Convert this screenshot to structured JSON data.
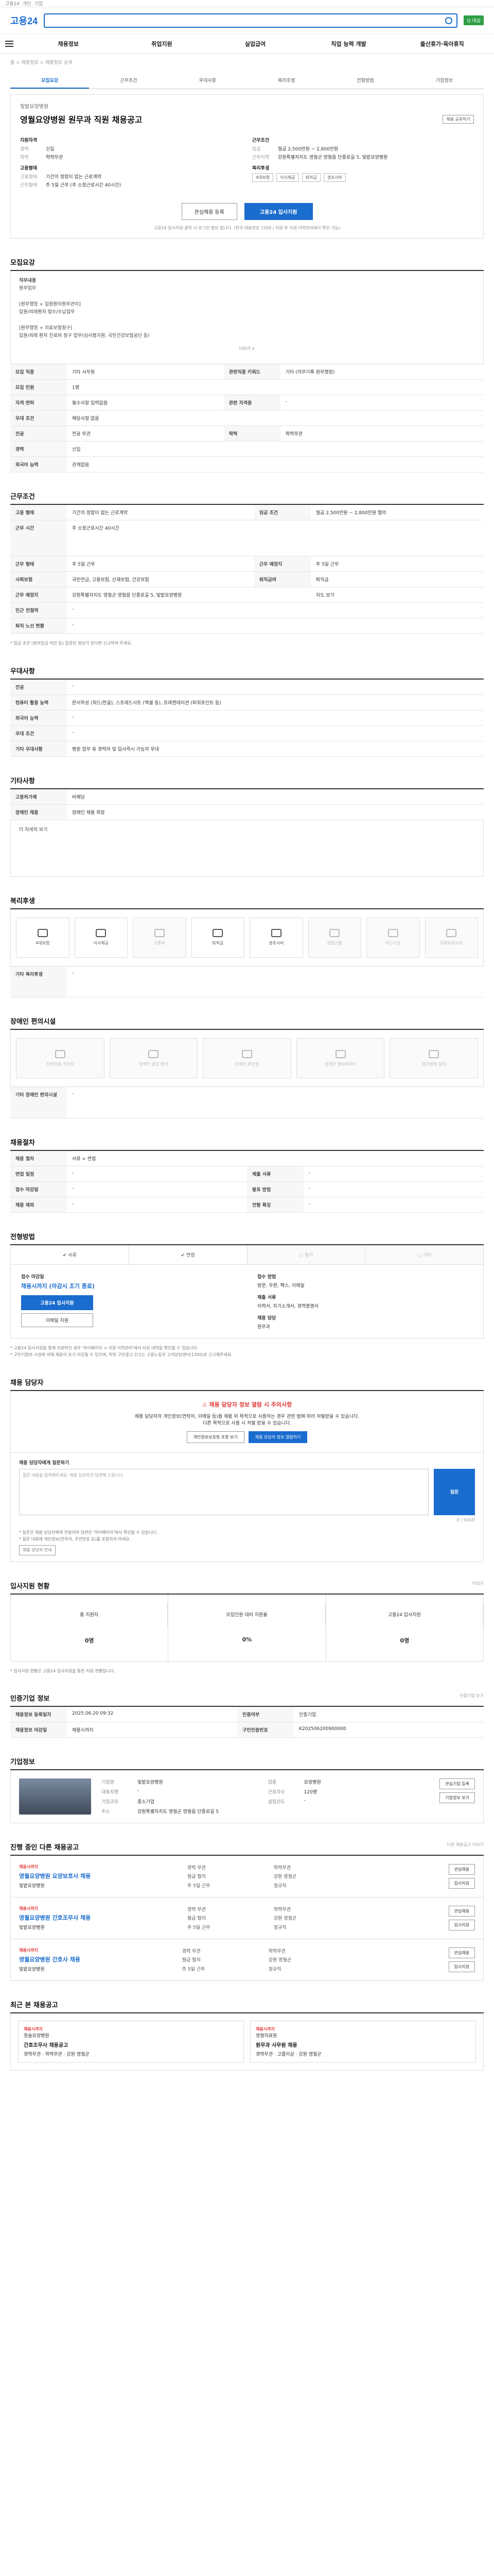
{
  "header": {
    "top_links": [
      "고용24",
      "개인",
      "기업"
    ],
    "logo": "고용24",
    "badge": "Q 대상",
    "gnb": [
      "채용정보",
      "취업지원",
      "실업급여",
      "직업 능력 개발",
      "출산휴가·육아휴직"
    ]
  },
  "breadcrumb": "홈 > 채용정보 > 채용정보 상세",
  "tabs": [
    "모집요강",
    "근무조건",
    "우대사항",
    "복리후생",
    "전형방법",
    "기업정보"
  ],
  "job": {
    "company": "빛밭요양병원",
    "title": "영월요양병원 원무과 직원 채용공고",
    "share": "채용 공유하기",
    "left_label": "지원자격",
    "left_rows": [
      {
        "k": "경력",
        "v": "신입"
      },
      {
        "k": "학력",
        "v": "학력무관"
      }
    ],
    "left_label2": "고용형태",
    "left_rows2": [
      {
        "k": "고용형태",
        "v": "기간의 정함이 없는 근로계약"
      },
      {
        "k": "근무형태",
        "v": "주 5일 근무 (주 소정근로시간 40시간)"
      }
    ],
    "right_label": "근무조건",
    "right_rows": [
      {
        "k": "임금",
        "v": "월급 2,500만원 ~ 2,800만원"
      },
      {
        "k": "근무지역",
        "v": "강원특별자치도 영월군 영월읍 단종로길 5, 빛밭요양병원"
      }
    ],
    "right_label2": "복리후생",
    "chips": [
      "4대보험",
      "식사제공",
      "퇴직금",
      "경조사비"
    ],
    "btn_interest": "관심채용 등록",
    "btn_apply": "고용24 입사지원",
    "cta_note": "고용24 입사지원 클릭 시 로그인 필요 합니다. (한국 대표번호 1350 / 지원 후 지원 이력관리에서 확인 가능)"
  },
  "recruit": {
    "title": "모집요강",
    "duty_label": "직무내용",
    "duty_text": "원무업무",
    "body": [
      "[원무행정 + 입원환자원무관리]",
      "입원/외래환자 접수/수납업무",
      "[원무행정 + 의료보험청구]",
      "입원/외래 환자 진료비 청구 업무(심사평가원, 국민건강보험공단 등)"
    ],
    "fold": "더보기 ∨",
    "rows": [
      {
        "k": "모집 직종",
        "v": "기타 사무원",
        "k2": "관련직종 키워드",
        "v2": "기타 (의무기록 원무행정)"
      },
      {
        "k": "모집 인원",
        "v": "1명",
        "k2": "",
        "v2": ""
      },
      {
        "k": "자격 면허",
        "v": "필수사항 입력없음",
        "k2": "관련 자격증",
        "v2": "-"
      },
      {
        "k": "우대 조건",
        "v": "해당사항 없음",
        "k2": "",
        "v2": ""
      },
      {
        "k": "전공",
        "v": "전공 무관",
        "k2": "학력",
        "v2": "학력무관"
      },
      {
        "k": "경력",
        "v": "신입",
        "k2": "",
        "v2": ""
      },
      {
        "k": "외국어 능력",
        "v": "관계없음",
        "k2": "",
        "v2": ""
      }
    ]
  },
  "conditions": {
    "title": "근무조건",
    "rows": [
      {
        "k": "고용 형태",
        "v": "기간의 정함이 없는 근로계약",
        "k2": "임금 조건",
        "v2": "월급 2,500만원 ~ 2,800만원 협의"
      },
      {
        "k": "근무 시간",
        "v": "주 소정근로시간 40시간",
        "k2": "",
        "v2": ""
      },
      {
        "k": "근무 형태",
        "v": "주 5일 근무",
        "k2": "근무 예정지",
        "v2": "주 5일 근무"
      },
      {
        "k": "사회보험",
        "v": "국민연금, 고용보험, 산재보험, 건강보험",
        "k2": "퇴직급여",
        "v2": "퇴직금"
      },
      {
        "k": "근무 예정지",
        "v": "강원특별자치도 영월군 영월읍 단종로길 5, 빛밭요양병원",
        "k2": "",
        "v2": "지도 보기"
      },
      {
        "k": "인근 전철역",
        "v": "-",
        "k2": "",
        "v2": ""
      },
      {
        "k": "퇴직 노선 현황",
        "v": "-",
        "k2": "",
        "v2": ""
      }
    ],
    "note": "* 임금 조건 (최저임금 미만 등) 잘못된 정보가 있다면 신고하여 주세요."
  },
  "prefer": {
    "title": "우대사항",
    "rows": [
      {
        "k": "전공",
        "v": "-"
      },
      {
        "k": "컴퓨터 활용 능력",
        "v": "문서작성 (워드/한글), 스프레드시트 (엑셀 등), 프레젠테이션 (파워포인트 등)"
      },
      {
        "k": "외국어 능력",
        "v": "-"
      },
      {
        "k": "우대 조건",
        "v": "-"
      },
      {
        "k": "기타 우대사항",
        "v": "병원 업무 유 경력자 및 입사즉시 가능자 우대"
      }
    ]
  },
  "other": {
    "title": "기타사항",
    "rows": [
      {
        "k": "고용허가제",
        "v": "비해당"
      },
      {
        "k": "장애인 채용",
        "v": "장애인 채용 희망"
      }
    ],
    "fold": "더 자세히 보기"
  },
  "welfare": {
    "title": "복리후생",
    "items": [
      {
        "label": "4대보험",
        "on": true
      },
      {
        "label": "식사제공",
        "on": true
      },
      {
        "label": "교통비",
        "on": false
      },
      {
        "label": "퇴직금",
        "on": true
      },
      {
        "label": "경조사비",
        "on": true
      },
      {
        "label": "명절선물",
        "on": false
      },
      {
        "label": "야근수당",
        "on": false
      },
      {
        "label": "차량유류보조",
        "on": false
      }
    ],
    "extra_label": "기타 복리후생",
    "extra_value": "-"
  },
  "disabled": {
    "title": "장애인 편의시설",
    "items": [
      "장애인용 주차장",
      "장애인 출입 편의",
      "장애인 화장실",
      "장애인 엘리베이터",
      "점자블록 설치"
    ],
    "extra_label": "기타 장애인 편의시설",
    "extra_value": "-"
  },
  "process": {
    "title": "채용절차",
    "rows": [
      {
        "k": "채용 절차",
        "v": "서류 > 면접",
        "k2": "",
        "v2": ""
      },
      {
        "k": "면접 일정",
        "v": "-",
        "k2": "제출 서류",
        "v2": "-"
      },
      {
        "k": "접수 마감일",
        "v": "-",
        "k2": "발표 방법",
        "v2": "-"
      },
      {
        "k": "채용 제외",
        "v": "-",
        "k2": "전형 특징",
        "v2": "-"
      }
    ]
  },
  "method": {
    "title": "전형방법",
    "items": [
      {
        "label": "서류",
        "on": true
      },
      {
        "label": "면접",
        "on": true
      },
      {
        "label": "필기",
        "on": false
      },
      {
        "label": "기타",
        "on": false
      }
    ]
  },
  "apply": {
    "deadline_label": "접수 마감일",
    "deadline": "채용시까지 (마감시 조기 종료)",
    "btn_apply": "고용24 입사지원",
    "btn_other": "이메일 지원",
    "method_label": "접수 방법",
    "method_value": "방문, 우편, 팩스, 이메일",
    "docs_label": "제출 서류",
    "docs_value": "이력서, 자기소개서, 경력증명서",
    "contact_label": "채용 담당",
    "contact_value": "원무과",
    "notes": [
      "* 고용24 입사지원을 통해 지원하신 경우 '마이페이지 > 지원 이력관리'에서 지원 내역을 확인할 수 있습니다.",
      "* 구인기업의 사정에 의해 채용이 조기 마감될 수 있으며, 허위 구인광고 신고는 고용노동부 고객상담센터(1350)로 신고해주세요."
    ]
  },
  "report": {
    "title": "채용 담당자",
    "alert": "채용 담당자 정보 열람 시 주의사항",
    "text1": "채용 담당자의 개인정보(연락처, 이메일 등)를 채용 외 목적으로 사용하는 경우 관련 법에 따라 처벌받을 수 있습니다.",
    "text2": "다른 목적으로 사용 시 처벌 받을 수 있습니다.",
    "btn1": "개인정보보호법 조항 보기",
    "btn2": "채용 담당자 정보 열람하기",
    "qa_label": "채용 담당자에게 질문하기",
    "qa_placeholder": "질문 내용을 입력해주세요. 채용 담당자가 답변해 드립니다.",
    "qa_btn": "질문",
    "qa_count": "0 / 500자",
    "notes": [
      "* 질문은 채용 담당자에게 전달되며 답변은 '마이페이지'에서 확인할 수 있습니다.",
      "* 질문 내용에 개인정보(연락처, 주민번호 등)를 포함하지 마세요."
    ],
    "notice_link": "채용 담당자 안내"
  },
  "status": {
    "title": "입사지원 현황",
    "more": "더보기",
    "items": [
      {
        "label": "총 지원자",
        "value": "0명"
      },
      {
        "label": "모집인원 대비 지원율",
        "value": "0%"
      },
      {
        "label": "고용24 입사지원",
        "value": "0명"
      }
    ],
    "note": "* 입사지원 현황은 고용24 입사지원을 통한 지원 현황입니다."
  },
  "reg": {
    "title": "인증기업 정보",
    "more": "인증기업 보기",
    "rows": [
      {
        "k": "채용정보 등록일자",
        "v": "2025.06.20 09:32",
        "k2": "인증여부",
        "v2": "인증기업"
      },
      {
        "k": "채용정보 마감일",
        "v": "채용시까지",
        "k2": "구인인증번호",
        "v2": "K202506200900000"
      }
    ]
  },
  "company": {
    "title": "기업정보",
    "rows": [
      {
        "k": "기업명",
        "v": "빛밭요양병원",
        "k2": "업종",
        "v2": "요양병원"
      },
      {
        "k": "대표자명",
        "v": "-",
        "k2": "근로자수",
        "v2": "120명"
      },
      {
        "k": "기업규모",
        "v": "중소기업",
        "k2": "설립년도",
        "v2": "-"
      },
      {
        "k": "주소",
        "v": "강원특별자치도 영월군 영월읍 단종로길 5",
        "k2": "",
        "v2": ""
      }
    ],
    "btn1": "관심기업 등록",
    "btn2": "기업정보 보기"
  },
  "similar": {
    "title": "진행 중인 다른 채용공고",
    "more": "다른 채용공고 더보기",
    "jobs": [
      {
        "tag": "채용시까지",
        "title": "영월요양병원 요양보호사 채용",
        "company": "빛밭요양병원",
        "meta": [
          "경력 무관",
          "학력무관",
          "월급 협의",
          "강원 영월군",
          "주 5일 근무",
          "정규직"
        ]
      },
      {
        "tag": "채용시까지",
        "title": "영월요양병원 간호조무사 채용",
        "company": "빛밭요양병원",
        "meta": [
          "경력 무관",
          "학력무관",
          "월급 협의",
          "강원 영월군",
          "주 5일 근무",
          "정규직"
        ]
      },
      {
        "tag": "채용시까지",
        "title": "영월요양병원 간호사 채용",
        "company": "빛밭요양병원",
        "meta": [
          "경력 무관",
          "학력무관",
          "월급 협의",
          "강원 영월군",
          "주 5일 근무",
          "정규직"
        ]
      }
    ],
    "btn1": "관심채용",
    "btn2": "입사지원"
  },
  "recent": {
    "title": "최근 본 채용공고",
    "cards": [
      {
        "tag": "채용시까지",
        "company": "청솔요양병원",
        "title": "간호조무사 채용공고",
        "meta": "경력무관 · 학력무관 · 강원 영월군"
      },
      {
        "tag": "채용시까지",
        "company": "영월의료원",
        "title": "원무과 사무원 채용",
        "meta": "경력무관 · 고졸이상 · 강원 영월군"
      }
    ]
  }
}
